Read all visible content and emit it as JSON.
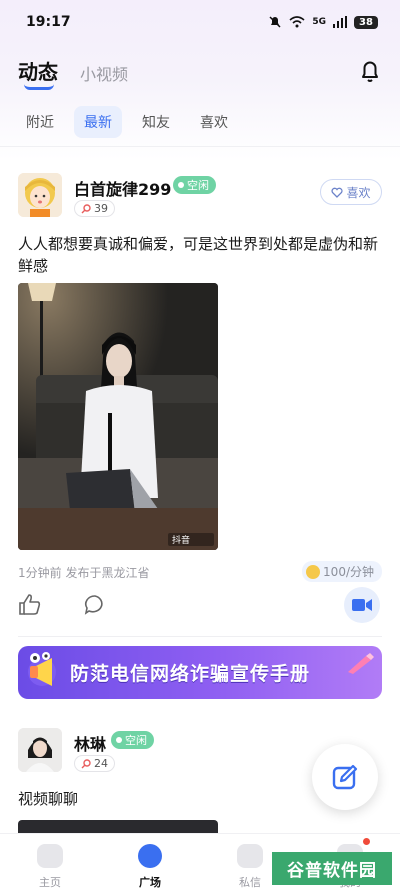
{
  "status_bar": {
    "time": "19:17",
    "battery": "38",
    "network": "5G"
  },
  "header": {
    "main_tab": "动态",
    "secondary_tab": "小视频"
  },
  "filters": [
    "附近",
    "最新",
    "知友",
    "喜欢"
  ],
  "posts": [
    {
      "username": "白首旋律299",
      "status": "空闲",
      "level": "39",
      "like_label": "喜欢",
      "text": "人人都想要真诚和偏爱，可是这世界到处都是虚伪和新鲜感",
      "photo_watermark": "抖音",
      "meta": "1分钟前  发布于黑龙江省",
      "price": "100/分钟"
    },
    {
      "username": "林琳",
      "status": "空闲",
      "level": "24",
      "text": "视频聊聊"
    }
  ],
  "banner": {
    "text": "防范电信网络诈骗宣传手册"
  },
  "bottom_nav": [
    {
      "label": "主页"
    },
    {
      "label": "广场"
    },
    {
      "label": "私信"
    },
    {
      "label": "我的"
    }
  ],
  "watermark": "谷普软件园",
  "colors": {
    "accent": "#3a6ff0",
    "status_green": "#6fd3a4",
    "banner": "#7b52ec"
  }
}
